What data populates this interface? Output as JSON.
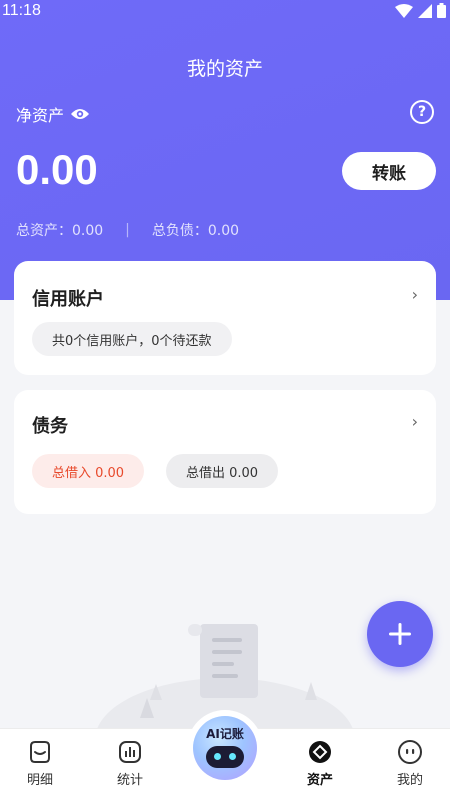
{
  "status_bar": {
    "time": "11:18"
  },
  "header": {
    "title": "我的资产"
  },
  "summary": {
    "net_label": "净资产",
    "net_value": "0.00",
    "transfer_label": "转账",
    "total_assets": "总资产：0.00",
    "separator": "|",
    "total_liabilities": "总负债：0.00"
  },
  "credit_card": {
    "title": "信用账户",
    "arrow": "›",
    "summary": "共0个信用账户，0个待还款"
  },
  "debt_card": {
    "title": "债务",
    "arrow": "›",
    "borrowed_in": "总借入 0.00",
    "lent_out": "总借出 0.00"
  },
  "ai_button": {
    "label": "AI记账"
  },
  "tabs": [
    {
      "label": "明细",
      "icon": "detail-icon"
    },
    {
      "label": "统计",
      "icon": "stats-icon"
    },
    {
      "label": "资产",
      "icon": "assets-icon",
      "active": true
    },
    {
      "label": "我的",
      "icon": "profile-icon"
    }
  ],
  "colors": {
    "brand": "#6a67f2",
    "borrow_in_text": "#e8492b",
    "borrow_in_bg": "#fdecea"
  }
}
